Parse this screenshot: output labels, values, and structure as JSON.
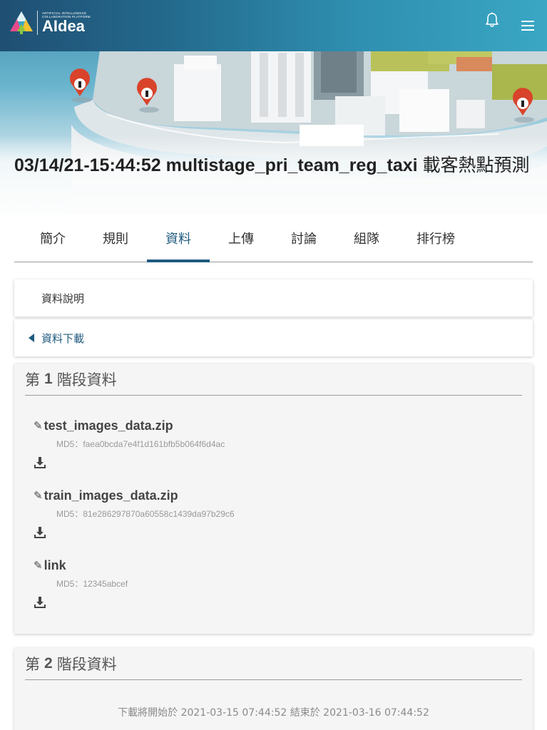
{
  "brand": {
    "logo_small_line1": "ARTIFICIAL INTELLIGENCE",
    "logo_small_line2": "COLLABORATION PLATFORM",
    "logo_word": "AIdea"
  },
  "header_icons": {
    "bell": "bell-icon",
    "menu": "hamburger-menu-icon"
  },
  "hero": {
    "title_bold": "03/14/21-15:44:52 multistage_pri_team_reg_taxi",
    "title_rest": " 載客熱點預測"
  },
  "tabs": [
    {
      "label": "簡介",
      "active": false
    },
    {
      "label": "規則",
      "active": false
    },
    {
      "label": "資料",
      "active": true
    },
    {
      "label": "上傳",
      "active": false
    },
    {
      "label": "討論",
      "active": false
    },
    {
      "label": "組隊",
      "active": false
    },
    {
      "label": "排行榜",
      "active": false
    }
  ],
  "sections": {
    "data_description": "資料說明",
    "data_download": "資料下載"
  },
  "stage1": {
    "prefix": "第",
    "number": "1",
    "suffix": "階段資料",
    "files": [
      {
        "name": "test_images_data.zip",
        "md5": "MD5：faea0bcda7e4f1d161bfb5b064f6d4ac"
      },
      {
        "name": "train_images_data.zip",
        "md5": "MD5：81e286297870a60558c1439da97b29c6"
      },
      {
        "name": "link",
        "md5": "MD5：12345abcef"
      }
    ]
  },
  "stage2": {
    "prefix": "第",
    "number": "2",
    "suffix": "階段資料",
    "note": "下載將開始於 2021-03-15 07:44:52 結束於 2021-03-16 07:44:52"
  },
  "colors": {
    "accent": "#1f5a7e",
    "topbar": "#23698c"
  }
}
